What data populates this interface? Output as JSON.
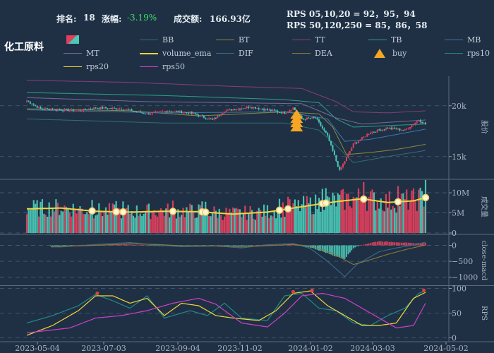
{
  "header": {
    "rank_label": "排名:",
    "rank_value": "18",
    "change_label": "涨幅:",
    "change_value": "-3.19%",
    "amount_label": "成交额:",
    "amount_value": "166.93亿",
    "rps_line1": "RPS 05,10,20 = 92，95，94",
    "rps_line2": "RPS 50,120,250 = 85，86，58"
  },
  "title": "化工原料",
  "colors": {
    "background": "#1f3044",
    "up": "#e0405e",
    "down": "#4bc8b6",
    "volume_ema": "#f2d43a",
    "buy": "#f5a623",
    "change_negative": "#3ee06e"
  },
  "legend": [
    {
      "label": "",
      "color": "#e0405e",
      "style": "candle-icon"
    },
    {
      "label": "BB",
      "color": "#2f6f73",
      "style": "line"
    },
    {
      "label": "BT",
      "color": "#8a8a3c",
      "style": "line"
    },
    {
      "label": "TT",
      "color": "#8a3c7a",
      "style": "line"
    },
    {
      "label": "TB",
      "color": "#2aa08a",
      "style": "line"
    },
    {
      "label": "MB",
      "color": "#3a78b0",
      "style": "line"
    },
    {
      "label": "MT",
      "color": "#7a6a9a",
      "style": "line"
    },
    {
      "label": "volume_ema",
      "color": "#f2d43a",
      "style": "line"
    },
    {
      "label": "DIF",
      "color": "#3a6a8a",
      "style": "line"
    },
    {
      "label": "DEA",
      "color": "#8a7a3a",
      "style": "line"
    },
    {
      "label": "buy",
      "color": "#f5a623",
      "style": "triangle-icon"
    },
    {
      "label": "rps10",
      "color": "#1f8a8a",
      "style": "line"
    },
    {
      "label": "rps20",
      "color": "#f2d43a",
      "style": "line-dot"
    },
    {
      "label": "rps50",
      "color": "#d040c8",
      "style": "line"
    }
  ],
  "chart_data": [
    {
      "type": "candlestick",
      "ylabel": "股价",
      "ylim": [
        12900,
        22900
      ],
      "yticks": [
        {
          "v": 15000,
          "label": "15k"
        },
        {
          "v": 20000,
          "label": "20k"
        }
      ],
      "x_dates": [
        "2023-05-04",
        "2023-07-03",
        "2023-09-04",
        "2023-11-02",
        "2024-01-02",
        "2024-03-03",
        "2024-05-02"
      ],
      "close_key_points": [
        [
          0,
          20500
        ],
        [
          8,
          19700
        ],
        [
          20,
          19600
        ],
        [
          30,
          19500
        ],
        [
          40,
          19800
        ],
        [
          55,
          19700
        ],
        [
          70,
          19200
        ],
        [
          82,
          19500
        ],
        [
          95,
          19300
        ],
        [
          108,
          18600
        ],
        [
          115,
          19500
        ],
        [
          130,
          19900
        ],
        [
          150,
          19300
        ],
        [
          155,
          19800
        ],
        [
          160,
          18700
        ],
        [
          168,
          18800
        ],
        [
          175,
          17000
        ],
        [
          182,
          13600
        ],
        [
          190,
          16200
        ],
        [
          200,
          17400
        ],
        [
          210,
          17800
        ],
        [
          220,
          17600
        ],
        [
          228,
          18600
        ],
        [
          232,
          18200
        ]
      ],
      "lines": {
        "TT": [
          [
            0,
            22500
          ],
          [
            60,
            22300
          ],
          [
            120,
            21900
          ],
          [
            160,
            21700
          ],
          [
            180,
            20400
          ],
          [
            190,
            19400
          ],
          [
            210,
            19300
          ],
          [
            232,
            19500
          ]
        ],
        "TB": [
          [
            0,
            21300
          ],
          [
            80,
            21000
          ],
          [
            150,
            20600
          ],
          [
            170,
            20300
          ],
          [
            180,
            18700
          ],
          [
            190,
            17900
          ],
          [
            232,
            18200
          ]
        ],
        "BB": [
          [
            0,
            18700
          ],
          [
            80,
            18300
          ],
          [
            150,
            18300
          ],
          [
            170,
            17600
          ],
          [
            180,
            16100
          ],
          [
            190,
            14400
          ],
          [
            210,
            15000
          ],
          [
            232,
            15600
          ]
        ],
        "BT": [
          [
            0,
            19700
          ],
          [
            60,
            19500
          ],
          [
            100,
            19000
          ],
          [
            150,
            19400
          ],
          [
            170,
            19200
          ],
          [
            178,
            17900
          ],
          [
            186,
            15200
          ],
          [
            200,
            15400
          ],
          [
            215,
            15700
          ],
          [
            232,
            16200
          ]
        ],
        "MT": [
          [
            0,
            20800
          ],
          [
            70,
            20400
          ],
          [
            120,
            20300
          ],
          [
            160,
            20200
          ],
          [
            180,
            18800
          ],
          [
            195,
            18200
          ],
          [
            232,
            18600
          ]
        ],
        "MB": [
          [
            0,
            19600
          ],
          [
            80,
            19300
          ],
          [
            150,
            19400
          ],
          [
            175,
            18700
          ],
          [
            185,
            16500
          ],
          [
            200,
            16700
          ],
          [
            232,
            17700
          ]
        ]
      },
      "buy_signals": [
        {
          "i": 157,
          "price": 19000
        }
      ]
    },
    {
      "type": "bar",
      "ylabel": "成交量",
      "ylim": [
        0,
        13000000
      ],
      "yticks": [
        {
          "v": 0,
          "label": "0"
        },
        {
          "v": 5000000,
          "label": "5M"
        },
        {
          "v": 10000000,
          "label": "10M"
        }
      ],
      "volume_ema_points": [
        [
          0,
          6000000
        ],
        [
          20,
          6200000
        ],
        [
          40,
          5400000
        ],
        [
          60,
          5200000
        ],
        [
          80,
          5400000
        ],
        [
          100,
          5300000
        ],
        [
          120,
          4700000
        ],
        [
          140,
          5200000
        ],
        [
          155,
          6200000
        ],
        [
          170,
          7200000
        ],
        [
          180,
          7800000
        ],
        [
          195,
          8500000
        ],
        [
          210,
          7600000
        ],
        [
          225,
          8000000
        ],
        [
          232,
          8800000
        ]
      ],
      "markers_at": [
        38,
        52,
        56,
        85,
        102,
        104,
        147,
        152,
        172,
        174,
        196,
        216,
        232
      ]
    },
    {
      "type": "macd",
      "ylabel": "close-macd",
      "ylim": [
        -1250,
        300
      ],
      "yticks": [
        {
          "v": 0,
          "label": "0"
        },
        {
          "v": -500,
          "label": "−500"
        },
        {
          "v": -1000,
          "label": "−1000"
        }
      ],
      "dif_points": [
        [
          20,
          -50
        ],
        [
          40,
          30
        ],
        [
          60,
          90
        ],
        [
          75,
          10
        ],
        [
          90,
          -40
        ],
        [
          110,
          -20
        ],
        [
          125,
          -80
        ],
        [
          140,
          20
        ],
        [
          155,
          60
        ],
        [
          165,
          -100
        ],
        [
          175,
          -500
        ],
        [
          185,
          -980
        ],
        [
          192,
          -600
        ],
        [
          205,
          -200
        ],
        [
          215,
          -80
        ],
        [
          225,
          10
        ],
        [
          232,
          100
        ]
      ],
      "dea_points": [
        [
          20,
          -30
        ],
        [
          40,
          0
        ],
        [
          60,
          50
        ],
        [
          75,
          30
        ],
        [
          90,
          -10
        ],
        [
          110,
          -20
        ],
        [
          125,
          -50
        ],
        [
          140,
          -10
        ],
        [
          155,
          30
        ],
        [
          165,
          -20
        ],
        [
          178,
          -250
        ],
        [
          190,
          -600
        ],
        [
          200,
          -450
        ],
        [
          210,
          -280
        ],
        [
          222,
          -110
        ],
        [
          232,
          10
        ]
      ]
    },
    {
      "type": "line",
      "ylabel": "RPS",
      "ylim": [
        -5,
        105
      ],
      "yticks": [
        {
          "v": 0,
          "label": "0"
        },
        {
          "v": 50,
          "label": "50"
        },
        {
          "v": 100,
          "label": "100"
        }
      ],
      "series": [
        {
          "name": "rps10",
          "points": [
            [
              0,
              30
            ],
            [
              15,
              45
            ],
            [
              30,
              65
            ],
            [
              40,
              88
            ],
            [
              50,
              75
            ],
            [
              60,
              60
            ],
            [
              70,
              85
            ],
            [
              80,
              40
            ],
            [
              95,
              55
            ],
            [
              105,
              45
            ],
            [
              115,
              70
            ],
            [
              125,
              40
            ],
            [
              140,
              35
            ],
            [
              150,
              85
            ],
            [
              160,
              90
            ],
            [
              170,
              60
            ],
            [
              180,
              55
            ],
            [
              190,
              30
            ],
            [
              200,
              25
            ],
            [
              210,
              45
            ],
            [
              220,
              60
            ],
            [
              228,
              90
            ],
            [
              232,
              95
            ]
          ]
        },
        {
          "name": "rps20",
          "points": [
            [
              0,
              5
            ],
            [
              15,
              25
            ],
            [
              30,
              55
            ],
            [
              40,
              85
            ],
            [
              50,
              85
            ],
            [
              60,
              70
            ],
            [
              70,
              80
            ],
            [
              80,
              45
            ],
            [
              90,
              70
            ],
            [
              100,
              65
            ],
            [
              110,
              45
            ],
            [
              120,
              40
            ],
            [
              135,
              35
            ],
            [
              145,
              55
            ],
            [
              155,
              90
            ],
            [
              165,
              95
            ],
            [
              175,
              65
            ],
            [
              185,
              45
            ],
            [
              195,
              25
            ],
            [
              205,
              25
            ],
            [
              215,
              30
            ],
            [
              225,
              80
            ],
            [
              232,
              92
            ]
          ]
        },
        {
          "name": "rps50",
          "points": [
            [
              0,
              10
            ],
            [
              25,
              20
            ],
            [
              40,
              40
            ],
            [
              55,
              45
            ],
            [
              70,
              55
            ],
            [
              85,
              70
            ],
            [
              100,
              80
            ],
            [
              110,
              68
            ],
            [
              125,
              30
            ],
            [
              140,
              22
            ],
            [
              150,
              50
            ],
            [
              160,
              85
            ],
            [
              172,
              90
            ],
            [
              185,
              80
            ],
            [
              195,
              60
            ],
            [
              205,
              40
            ],
            [
              215,
              20
            ],
            [
              225,
              25
            ],
            [
              232,
              70
            ]
          ]
        }
      ],
      "red_markers_at": [
        [
          41,
          90
        ],
        [
          155,
          93
        ],
        [
          166,
          96
        ],
        [
          231,
          96
        ]
      ]
    }
  ]
}
